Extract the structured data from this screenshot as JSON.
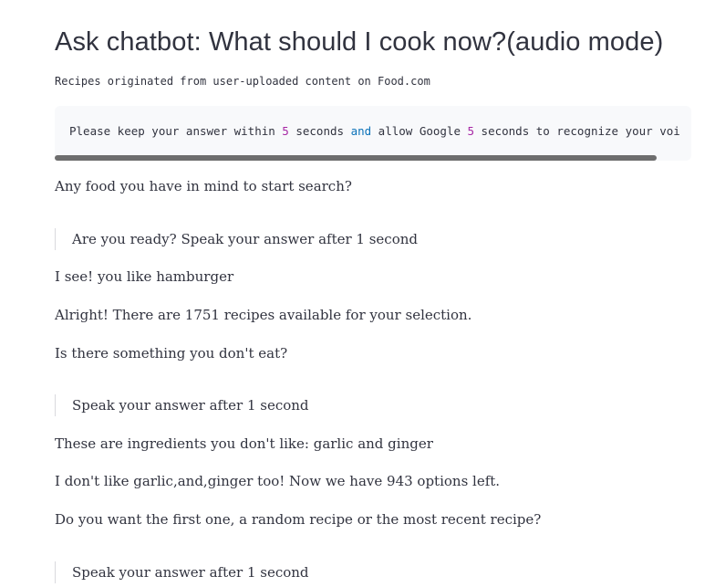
{
  "title": "Ask chatbot: What should I cook now?(audio mode)",
  "caption": "Recipes originated from user-uploaded content on Food.com",
  "code_box": {
    "t1": "Please keep your answer within ",
    "n1": "5",
    "t2": " seconds ",
    "kw": "and",
    "t3": " allow Google ",
    "n2": "5",
    "t4": " seconds to recognize your voi"
  },
  "chat": [
    {
      "type": "bot",
      "text": "Any food you have in mind to start search?"
    },
    {
      "type": "prompt",
      "text": "Are you ready? Speak your answer after 1 second"
    },
    {
      "type": "bot",
      "text": "I see! you like hamburger"
    },
    {
      "type": "bot",
      "text": "Alright! There are 1751 recipes available for your selection."
    },
    {
      "type": "bot",
      "text": "Is there something you don't eat?"
    },
    {
      "type": "prompt",
      "text": "Speak your answer after 1 second"
    },
    {
      "type": "bot",
      "text": "These are ingredients you don't like: garlic and ginger"
    },
    {
      "type": "bot",
      "text": "I don't like garlic,and,ginger too! Now we have 943 options left."
    },
    {
      "type": "bot",
      "text": "Do you want the first one, a random recipe or the most recent recipe?"
    },
    {
      "type": "prompt",
      "text": "Speak your answer after 1 second"
    }
  ]
}
